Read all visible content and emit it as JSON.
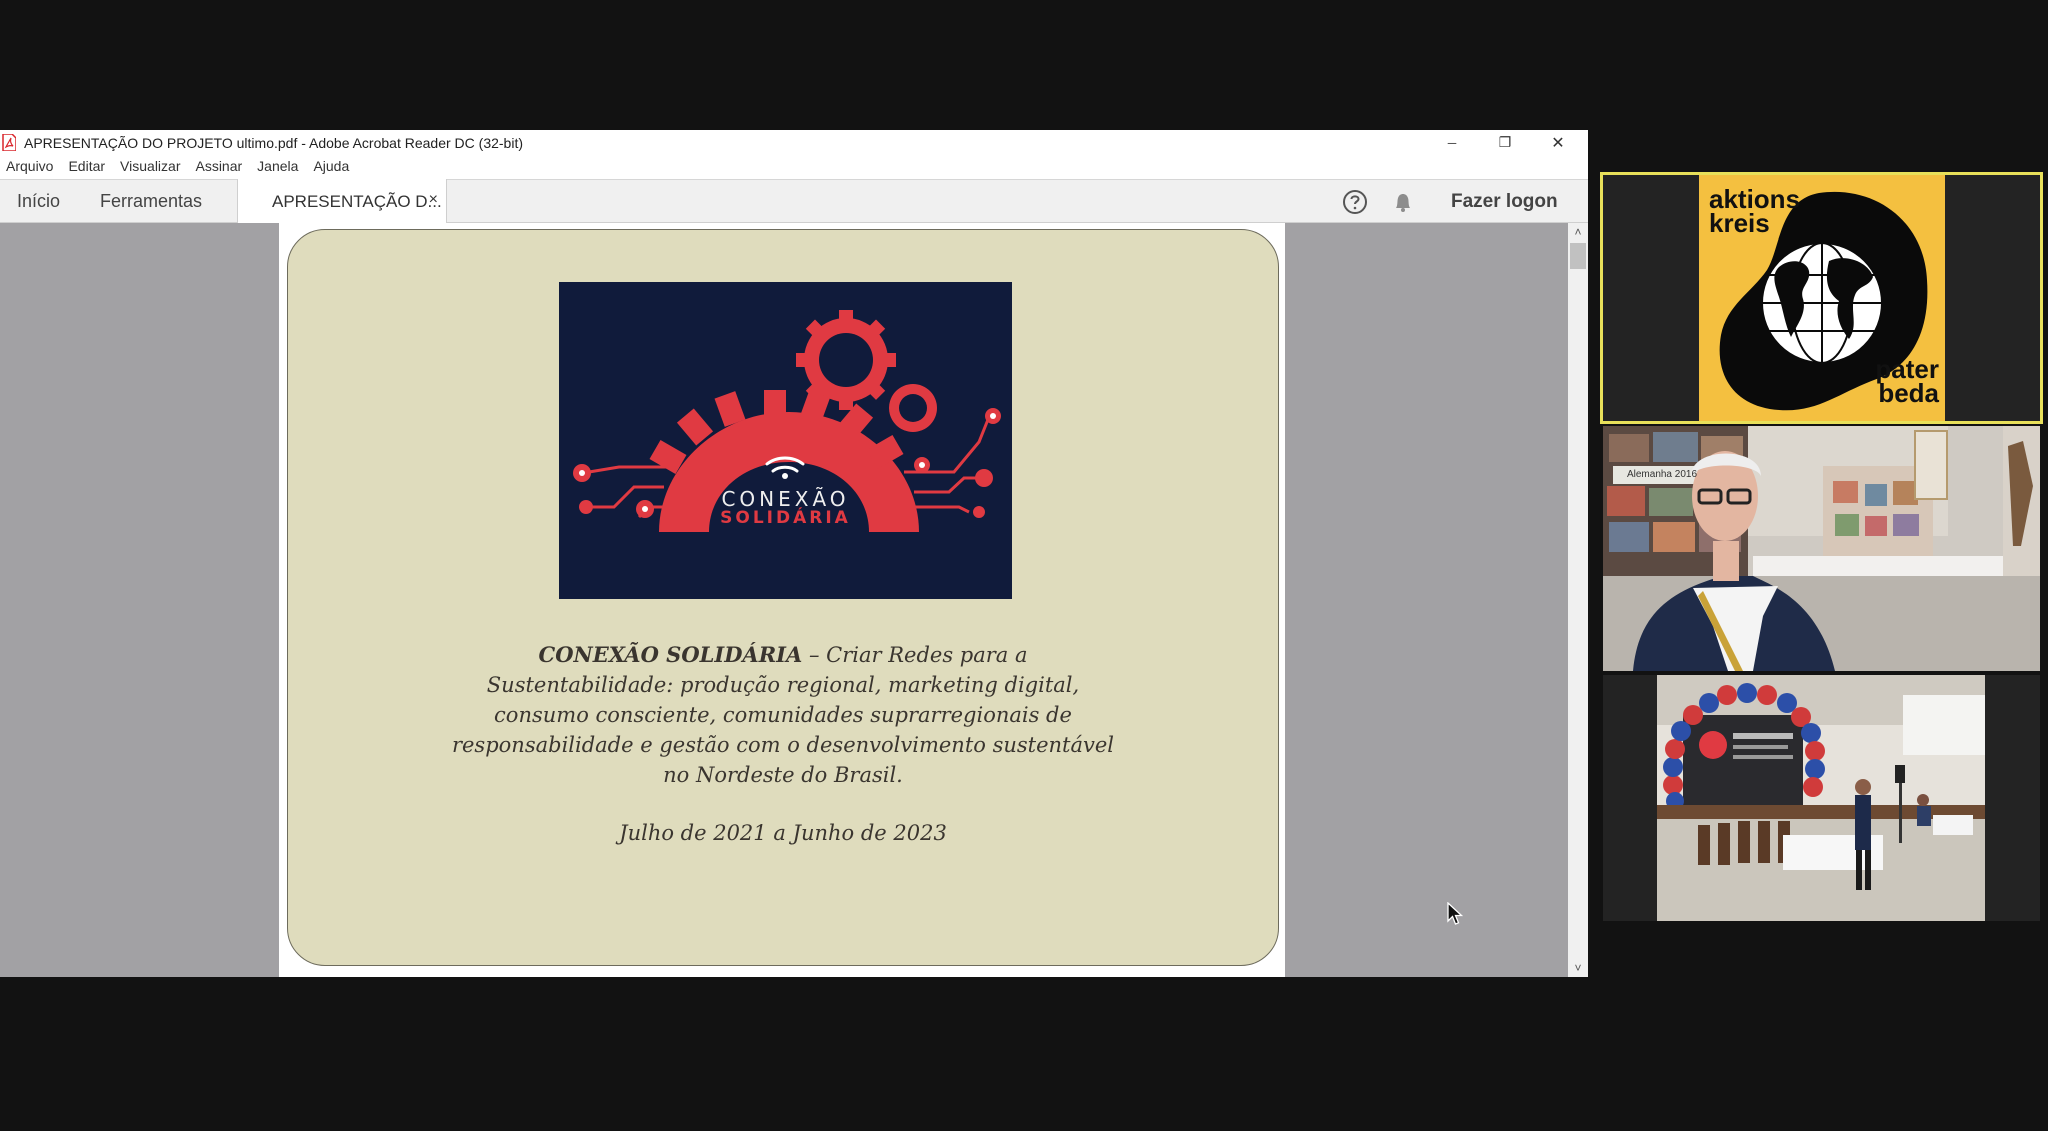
{
  "window": {
    "title": "APRESENTAÇÃO DO PROJETO ultimo.pdf - Adobe Acrobat Reader DC (32-bit)",
    "minimize_glyph": "─",
    "restore_glyph": "❐",
    "close_glyph": "✕"
  },
  "menu": [
    "Arquivo",
    "Editar",
    "Visualizar",
    "Assinar",
    "Janela",
    "Ajuda"
  ],
  "tabs": {
    "home": "Início",
    "tools": "Ferramentas",
    "document": "APRESENTAÇÃO D...",
    "close_glyph": "×"
  },
  "toolbar": {
    "help_icon": "question-circle-icon",
    "notification_icon": "bell-icon",
    "login": "Fazer logon"
  },
  "slide": {
    "logo_line1": "CONEXÃO",
    "logo_line2": "SOLIDÁRIA",
    "title_bold": "CONEXÃO SOLIDÁRIA",
    "title_rest": " – Criar Redes para a Sustentabilidade: produção regional, marketing digital, consumo consciente, comunidades suprarregionais de responsabilidade e gestão com o desenvolvimento sustentável no Nordeste do Brasil.",
    "date": "Julho de 2021 a Junho de 2023",
    "background_color": "#dfdcbd",
    "logo_background": "#101b3b",
    "logo_accent": "#e03a42"
  },
  "scrollbar": {
    "up_glyph": "˄",
    "down_glyph": "˅"
  },
  "participants": {
    "tile1": {
      "logo_top": "aktions kreis",
      "logo_bottom": "pater beda",
      "active_speaker_color": "#e8e05a",
      "logo_background": "#f4c040"
    },
    "tile2": {
      "banner": "Alemanha 2016"
    },
    "tile3": {}
  }
}
